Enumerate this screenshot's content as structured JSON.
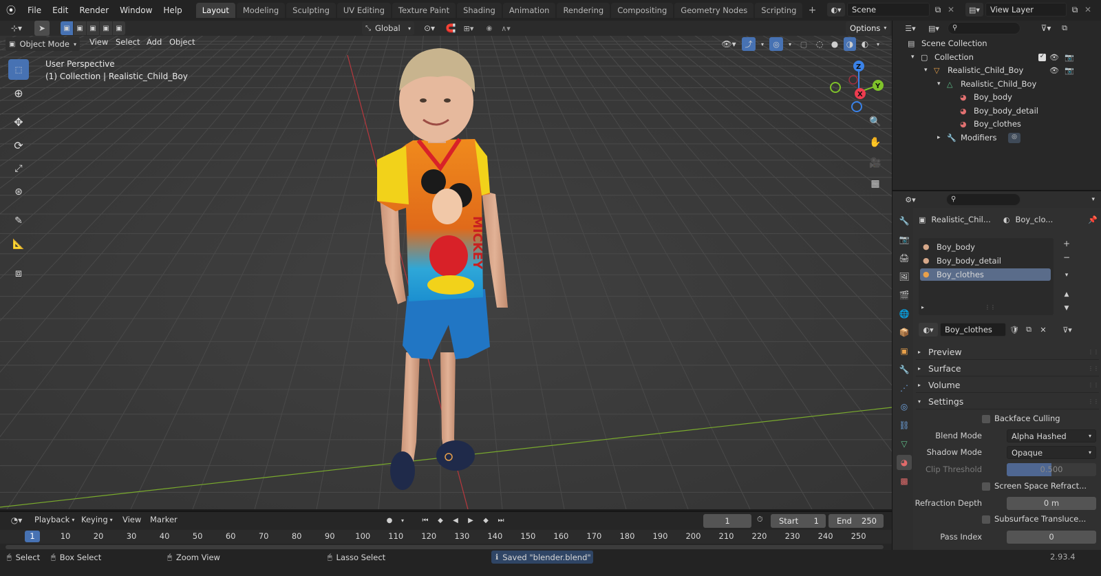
{
  "menu": [
    "File",
    "Edit",
    "Render",
    "Window",
    "Help"
  ],
  "workspaces": [
    "Layout",
    "Modeling",
    "Sculpting",
    "UV Editing",
    "Texture Paint",
    "Shading",
    "Animation",
    "Rendering",
    "Compositing",
    "Geometry Nodes",
    "Scripting"
  ],
  "active_workspace": "Layout",
  "scene_field": "Scene",
  "view_layer_field": "View Layer",
  "viewport": {
    "orientation": "Global",
    "options_label": "Options",
    "mode": "Object Mode",
    "menus": [
      "View",
      "Select",
      "Add",
      "Object"
    ],
    "overlay_line1": "User Perspective",
    "overlay_line2": "(1) Collection | Realistic_Child_Boy",
    "gizmo": {
      "x": "X",
      "y": "Y",
      "z": "Z"
    },
    "shirt_text": "MICKEY"
  },
  "outliner": {
    "rows": [
      {
        "label": "Scene Collection",
        "indent": 0,
        "icon": "scene-collection-icon",
        "arrow": ""
      },
      {
        "label": "Collection",
        "indent": 1,
        "icon": "collection-icon",
        "arrow": "▾"
      },
      {
        "label": "Realistic_Child_Boy",
        "indent": 2,
        "icon": "object-icon",
        "arrow": "▾"
      },
      {
        "label": "Realistic_Child_Boy",
        "indent": 3,
        "icon": "mesh-icon",
        "arrow": "▾"
      },
      {
        "label": "Boy_body",
        "indent": 4,
        "icon": "material-icon",
        "arrow": ""
      },
      {
        "label": "Boy_body_detail",
        "indent": 4,
        "icon": "material-icon",
        "arrow": ""
      },
      {
        "label": "Boy_clothes",
        "indent": 4,
        "icon": "material-icon",
        "arrow": ""
      },
      {
        "label": "Modifiers",
        "indent": 3,
        "icon": "wrench-icon",
        "arrow": "▸"
      }
    ]
  },
  "properties": {
    "breadcrumb_object": "Realistic_Chil...",
    "breadcrumb_material": "Boy_clo...",
    "slots": [
      "Boy_body",
      "Boy_body_detail",
      "Boy_clothes"
    ],
    "active_slot": "Boy_clothes",
    "material_name": "Boy_clothes",
    "sections": [
      "Preview",
      "Surface",
      "Volume",
      "Settings"
    ],
    "backface_culling": "Backface Culling",
    "blend_mode_label": "Blend Mode",
    "blend_mode_value": "Alpha Hashed",
    "shadow_mode_label": "Shadow Mode",
    "shadow_mode_value": "Opaque",
    "clip_threshold_label": "Clip Threshold",
    "clip_threshold_value": "0.500",
    "clip_threshold_fraction": 0.5,
    "screen_space_refract": "Screen Space Refract...",
    "refraction_depth_label": "Refraction Depth",
    "refraction_depth_value": "0 m",
    "subsurface_transluce": "Subsurface Transluce...",
    "pass_index_label": "Pass Index",
    "pass_index_value": "0"
  },
  "timeline": {
    "menus": [
      "Playback",
      "Keying",
      "View",
      "Marker"
    ],
    "current_frame": "1",
    "start_label": "Start",
    "start_value": "1",
    "end_label": "End",
    "end_value": "250",
    "ticks": [
      "10",
      "20",
      "30",
      "40",
      "50",
      "60",
      "70",
      "80",
      "90",
      "100",
      "110",
      "120",
      "130",
      "140",
      "150",
      "160",
      "170",
      "180",
      "190",
      "200",
      "210",
      "220",
      "230",
      "240",
      "250"
    ],
    "playhead": "1"
  },
  "status": {
    "select": "Select",
    "box_select": "Box Select",
    "zoom_view": "Zoom View",
    "lasso_select": "Lasso Select",
    "message": "Saved \"blender.blend\"",
    "version": "2.93.4"
  },
  "colors": {
    "accent": "#4772b3",
    "x_axis": "#ed3c4f",
    "y_axis": "#7fc22a",
    "z_axis": "#3a82e8"
  }
}
